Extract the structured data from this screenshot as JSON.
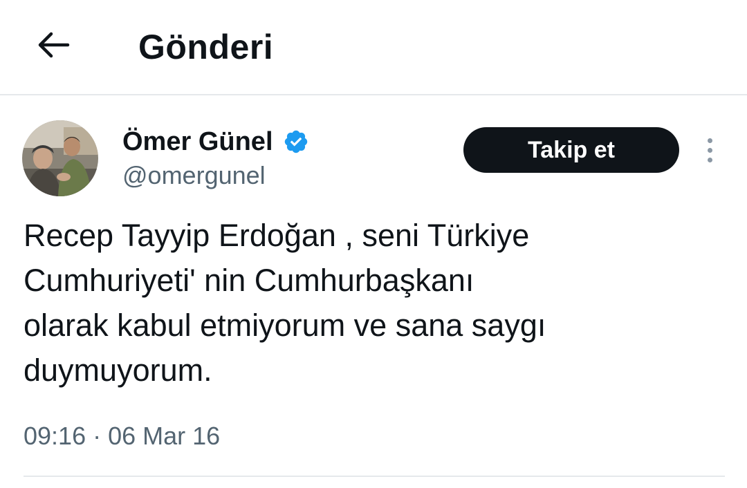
{
  "header": {
    "title": "Gönderi",
    "back_icon": "arrow-left-icon"
  },
  "author": {
    "display_name": "Ömer Günel",
    "handle": "@omergunel",
    "verified_icon": "verified-badge-icon",
    "verified_color": "#1d9bf0"
  },
  "actions": {
    "follow_label": "Takip et",
    "more_icon": "more-vertical-icon"
  },
  "tweet": {
    "text": "Recep Tayyip Erdoğan , seni Türkiye\nCumhuriyeti' nin Cumhurbaşkanı\nolarak kabul etmiyorum ve sana saygı\nduymuyorum.",
    "timestamp": "09:16 · 06 Mar 16"
  },
  "colors": {
    "text_primary": "#0f1419",
    "text_secondary": "#536471",
    "button_bg": "#0f1419",
    "divider": "#e5e8eb"
  }
}
